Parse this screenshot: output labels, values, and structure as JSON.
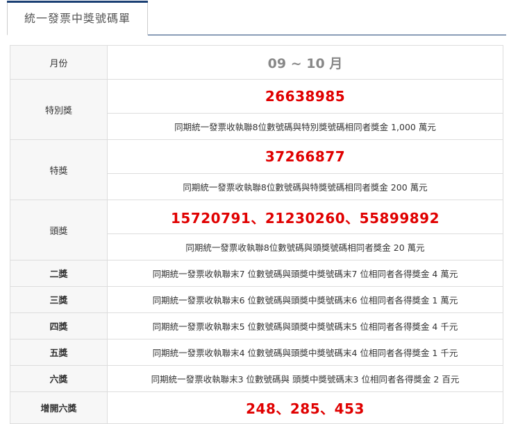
{
  "tab": {
    "label": "統一發票中獎號碼單"
  },
  "month": {
    "label": "月份",
    "value": "09 ~ 10 月"
  },
  "special": {
    "label": "特別獎",
    "number": "26638985",
    "desc": "同期統一發票收執聯8位數號碼與特別獎號碼相同者獎金 1,000 萬元"
  },
  "grand": {
    "label": "特獎",
    "number": "37266877",
    "desc": "同期統一發票收執聯8位數號碼與特獎號碼相同者獎金 200 萬元"
  },
  "first": {
    "label": "頭獎",
    "numbers": "15720791、21230260、55899892",
    "desc": "同期統一發票收執聯8位數號碼與頭獎號碼相同者獎金 20 萬元"
  },
  "second": {
    "label": "二獎",
    "desc": "同期統一發票收執聯末7 位數號碼與頭獎中獎號碼末7 位相同者各得獎金 4 萬元"
  },
  "third": {
    "label": "三獎",
    "desc": "同期統一發票收執聯末6 位數號碼與頭獎中獎號碼末6 位相同者各得獎金 1 萬元"
  },
  "fourth": {
    "label": "四獎",
    "desc": "同期統一發票收執聯末5 位數號碼與頭獎中獎號碼末5 位相同者各得獎金 4 千元"
  },
  "fifth": {
    "label": "五獎",
    "desc": "同期統一發票收執聯末4 位數號碼與頭獎中獎號碼末4 位相同者各得獎金 1 千元"
  },
  "sixth": {
    "label": "六獎",
    "desc": "同期統一發票收執聯末3 位數號碼與 頭獎中獎號碼末3 位相同者各得獎金 2 百元"
  },
  "extra_sixth": {
    "label": "增開六獎",
    "numbers": "248、285、453"
  },
  "colors": {
    "accent_navy": "#1a3f73",
    "number_red": "#e00000",
    "header_bg": "#f7f7f7",
    "border": "#dddddd"
  }
}
